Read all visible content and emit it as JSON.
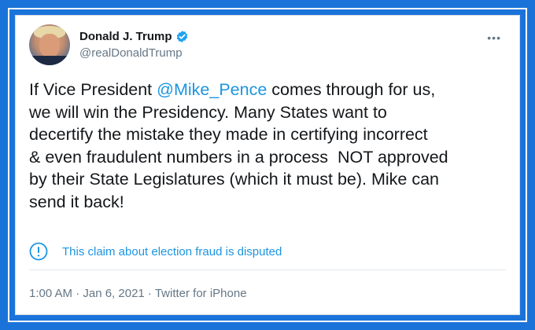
{
  "tweet": {
    "display_name": "Donald J. Trump",
    "handle": "@realDonaldTrump",
    "text_before_mention": "If Vice President ",
    "mention": "@Mike_Pence",
    "text_after_mention": " comes through for us,\nwe will win the Presidency. Many States want to\ndecertify the mistake they made in certifying incorrect\n& even fraudulent numbers in a process  NOT approved\nby their State Legislatures (which it must be). Mike can\nsend it back!",
    "notice": "This claim about election fraud is disputed",
    "timestamp": "1:00 AM · Jan 6, 2021 · Twitter for iPhone"
  },
  "icons": {
    "verified": "verified-badge-icon",
    "more": "more-icon",
    "notice": "exclamation-circle-icon"
  },
  "colors": {
    "frame": "#1a73d9",
    "link": "#1b95e0",
    "text": "#14171a",
    "secondary": "#657786"
  }
}
